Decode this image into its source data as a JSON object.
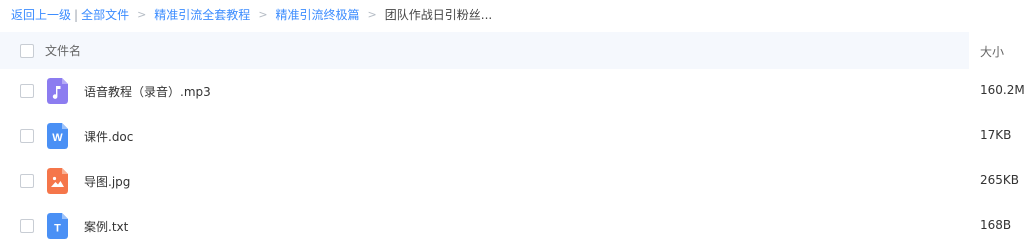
{
  "breadcrumb": {
    "back": "返回上一级",
    "pipe": "|",
    "all_files": "全部文件",
    "level1": "精准引流全套教程",
    "level2": "精准引流终极篇",
    "current": "团队作战日引粉丝...",
    "separator": ">"
  },
  "header": {
    "name_label": "文件名",
    "size_label": "大小"
  },
  "files": [
    {
      "name": "语音教程（录音）.mp3",
      "size": "160.2M",
      "icon": "audio-file-icon",
      "color": "#8c7cf0"
    },
    {
      "name": "课件.doc",
      "size": "17KB",
      "icon": "word-doc-icon",
      "color": "#4a90f5",
      "glyph": "W"
    },
    {
      "name": "导图.jpg",
      "size": "265KB",
      "icon": "image-file-icon",
      "color": "#f5764a"
    },
    {
      "name": "案例.txt",
      "size": "168B",
      "icon": "text-file-icon",
      "color": "#4a90f5",
      "glyph": "T"
    }
  ]
}
